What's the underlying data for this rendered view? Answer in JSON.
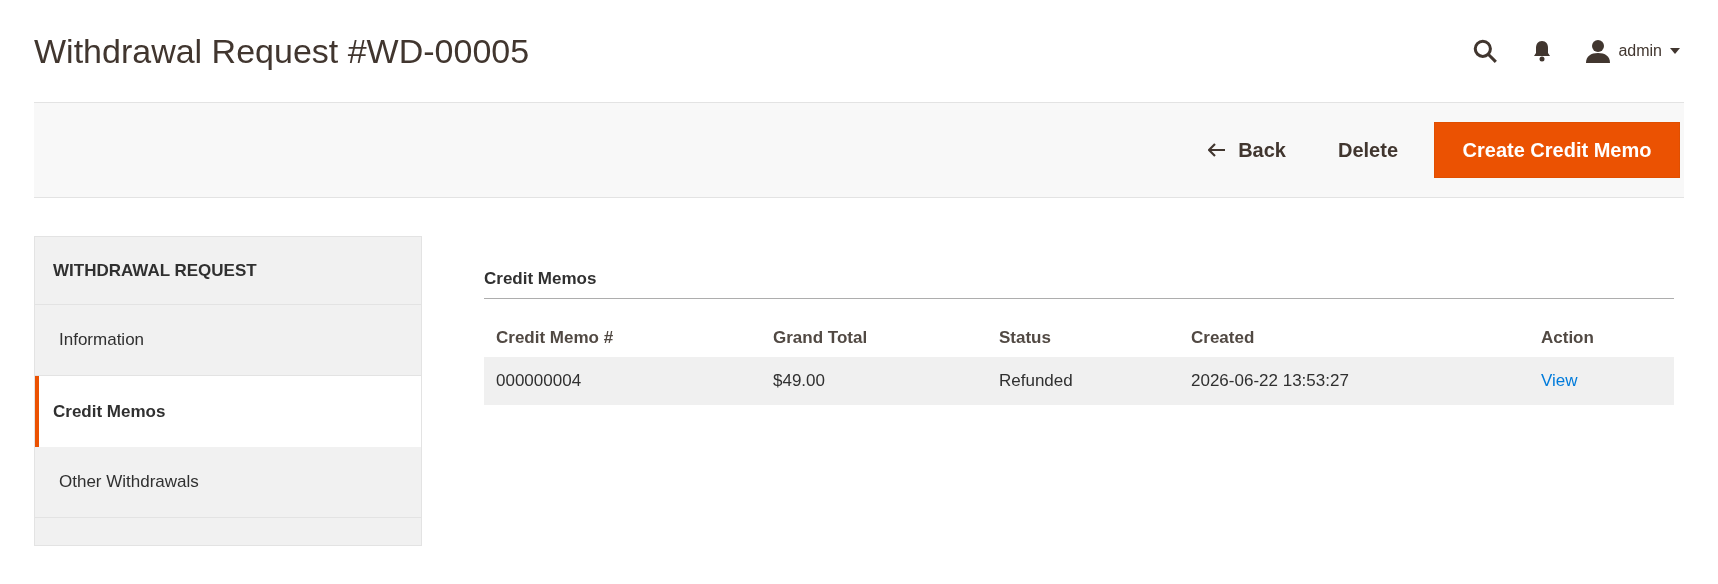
{
  "page_title": "Withdrawal Request #WD-00005",
  "header": {
    "user": "admin"
  },
  "actions": [
    {
      "kind": "back",
      "label": "Back"
    },
    {
      "kind": "plain",
      "label": "Delete"
    },
    {
      "kind": "primary",
      "label": "Create Credit Memo"
    }
  ],
  "sidebar": {
    "title": "WITHDRAWAL REQUEST",
    "items": [
      {
        "label": "Information",
        "selected": false
      },
      {
        "label": "Credit Memos",
        "selected": true
      },
      {
        "label": "Other Withdrawals",
        "selected": false
      }
    ]
  },
  "section": {
    "title": "Credit Memos",
    "table": {
      "columns": [
        "Credit Memo #",
        "Grand Total",
        "Status",
        "Created",
        "Action"
      ],
      "rows": [
        {
          "cells": [
            "000000004",
            "$49.00",
            "Refunded",
            "2026-06-22 13:53:27"
          ],
          "action": "View"
        }
      ]
    }
  }
}
